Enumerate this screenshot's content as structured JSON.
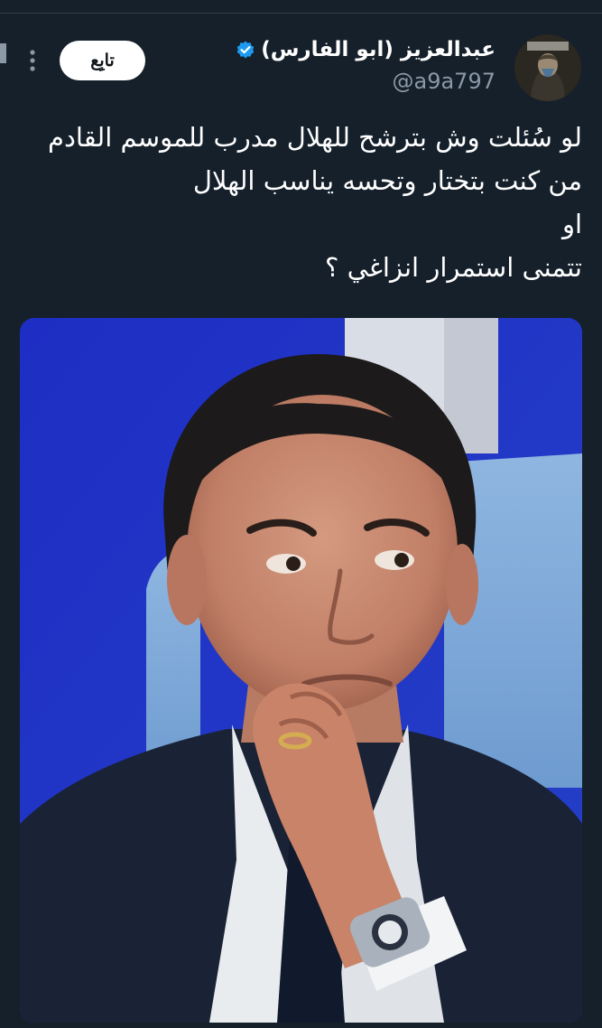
{
  "tweet": {
    "author": {
      "display_name": "عبدالعزيز (ابو الفارس)",
      "handle": "@a9a797",
      "verified": true,
      "verified_color": "#1d9bf0"
    },
    "follow_label": "تابِع",
    "more_icon": "more-vertical-icon",
    "text_lines": [
      "لو سُئلت وش بترشح للهلال مدرب للموسم القادم",
      "من كنت بتختار وتحسه يناسب الهلال",
      "او",
      "تتمنى استمرار انزاغي ؟"
    ],
    "media": {
      "type": "photo"
    }
  },
  "colors": {
    "background": "#15202b",
    "text": "#ffffff",
    "secondary_text": "#8b98a5",
    "follow_bg": "#ffffff"
  }
}
